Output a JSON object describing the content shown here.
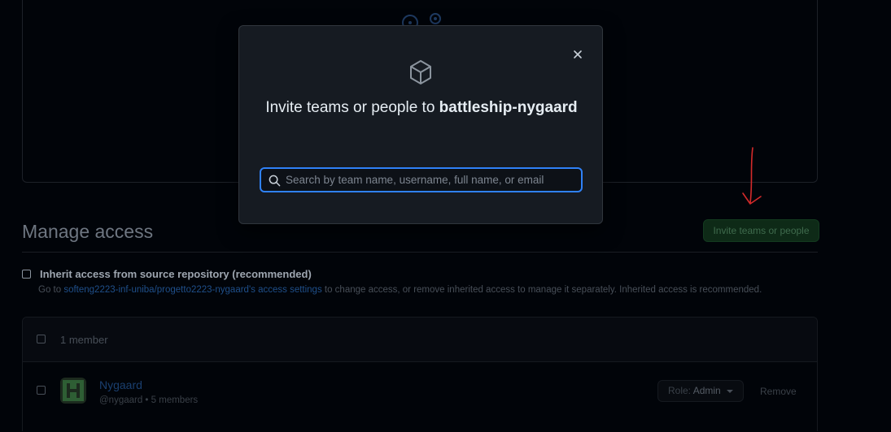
{
  "background": {
    "manage_access_title": "Manage access",
    "invite_button_label": "Invite teams or people",
    "inherit_label": "Inherit access from source repository (recommended)",
    "inherit_sub_prefix": "Go to ",
    "inherit_sub_link": "softeng2223-inf-uniba/progetto2223-nygaard's access settings",
    "inherit_sub_suffix": " to change access, or remove inherited access to manage it separately. Inherited access is recommended.",
    "members_count": "1 member",
    "member": {
      "name": "Nygaard",
      "sub": "@nygaard • 5 members",
      "role_prefix": "Role: ",
      "role_value": "Admin",
      "remove_label": "Remove"
    }
  },
  "modal": {
    "title_prefix": "Invite teams or people to ",
    "repo_name": "battleship-nygaard",
    "search_placeholder": "Search by team name, username, full name, or email",
    "search_value": ""
  },
  "colors": {
    "accent_blue": "#2f81f7",
    "annotation_red": "#d42a2a",
    "page_bg": "#010409",
    "modal_bg": "#161b22"
  }
}
